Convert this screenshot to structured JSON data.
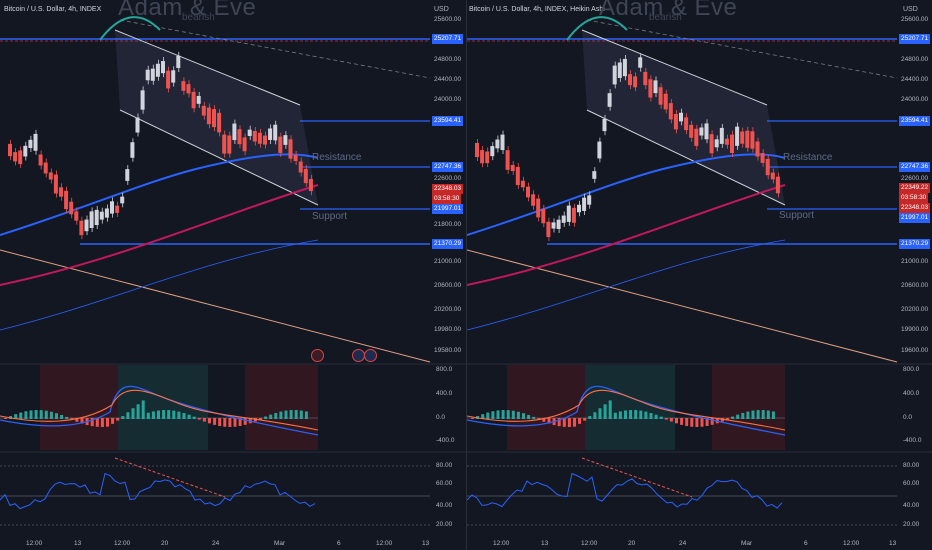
{
  "left": {
    "title": "Bitcoin / U.S. Dollar, 4h, INDEX",
    "watermark": "Adam & Eve",
    "watermark_sub": "bearish",
    "currency": "USD",
    "price_ticks": [
      "25600.00",
      "24800.00",
      "24400.00",
      "24000.00",
      "22600.00",
      "21800.00",
      "21400.00",
      "21000.00",
      "20600.00",
      "20200.00",
      "19980.00",
      "19580.00"
    ],
    "tags": [
      "25207.71",
      "23594.41",
      "22747.36",
      "22348.03",
      "03:58:30",
      "21997.01",
      "21370.29"
    ],
    "labels": {
      "resistance": "Resistance",
      "support": "Support"
    },
    "osc1_ticks": [
      "800.0",
      "400.0",
      "0.0",
      "-400.0"
    ],
    "osc2_ticks": [
      "80.00",
      "60.00",
      "40.00",
      "20.00"
    ],
    "x_labels": [
      "12:00",
      "13",
      "12:00",
      "20",
      "24",
      "Mar",
      "6",
      "12:00",
      "13"
    ]
  },
  "right": {
    "title": "Bitcoin / U.S. Dollar, 4h, INDEX, Heikin Ashi",
    "watermark": "Adam & Eve",
    "watermark_sub": "bearish",
    "currency": "USD",
    "price_ticks": [
      "25600.00",
      "24800.00",
      "24400.00",
      "24000.00",
      "22600.00",
      "21800.00",
      "21000.00",
      "20600.00",
      "20200.00",
      "19900.00",
      "19600.00"
    ],
    "tags": [
      "25207.71",
      "23594.41",
      "22747.36",
      "22349.22",
      "03:58:30",
      "22348.03",
      "21997.01",
      "21370.29"
    ],
    "labels": {
      "resistance": "Resistance",
      "support": "Support"
    },
    "osc1_ticks": [
      "800.0",
      "400.0",
      "0.0",
      "-400.0"
    ],
    "osc2_ticks": [
      "80.00",
      "60.00",
      "40.00",
      "20.00"
    ],
    "x_labels": [
      "12:00",
      "13",
      "12:00",
      "20",
      "24",
      "Mar",
      "6",
      "12:00",
      "13"
    ]
  },
  "colors": {
    "bg": "#131722",
    "blue": "#2962ff",
    "up": "#d1d4dc",
    "down": "#ef5350",
    "green": "#26a69a",
    "maroon": "#c2185b"
  }
}
